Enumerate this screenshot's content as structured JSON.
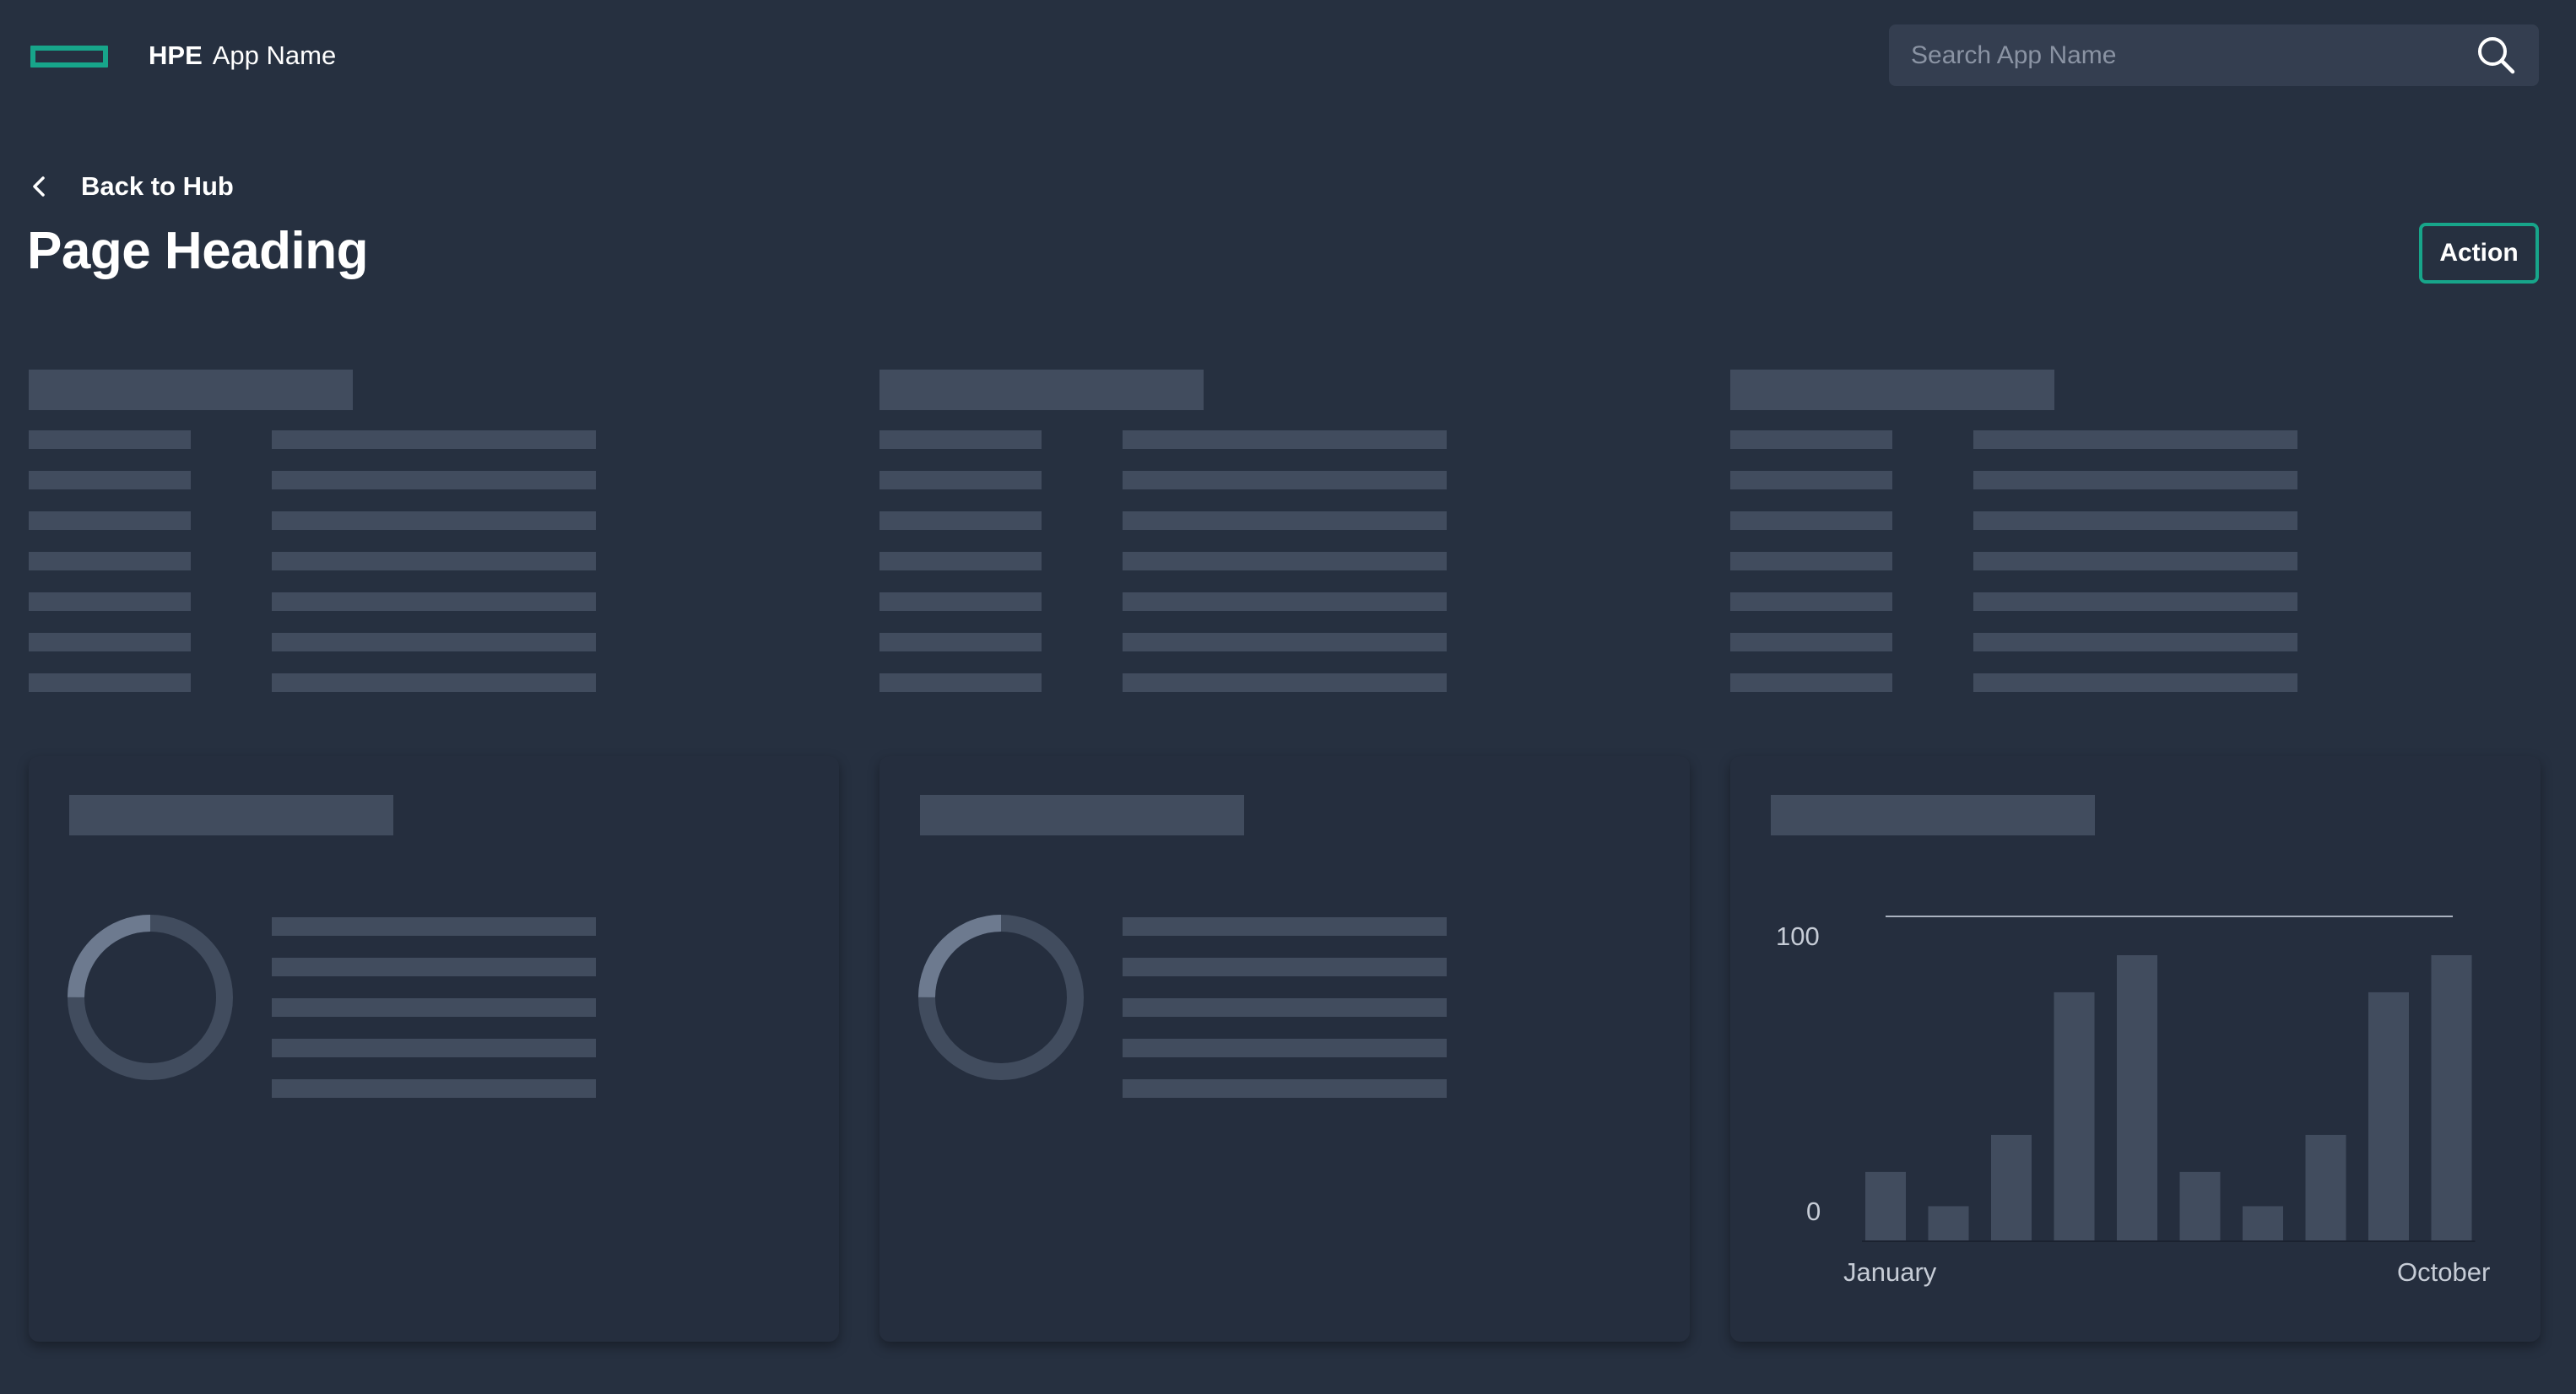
{
  "header": {
    "brand_bold": "HPE",
    "app_name": "App Name",
    "search_placeholder": "Search App Name"
  },
  "nav": {
    "back_label": "Back to Hub"
  },
  "page": {
    "heading": "Page Heading",
    "action_label": "Action"
  },
  "colors": {
    "background": "#263040",
    "card": "#252e3e",
    "skeleton": "#414c5e",
    "accent": "#17a58a",
    "donut_ring": "#414c5e",
    "donut_segment": "#6d7a8f"
  },
  "icons": {
    "search": "search-icon",
    "back": "chevron-left-icon",
    "logo": "hpe-element-logo"
  },
  "chart_data": {
    "type": "bar",
    "title": "",
    "xlabel": "",
    "ylabel": "",
    "x_tick_labels": [
      "January",
      "October"
    ],
    "y_tick_labels": [
      "0",
      "100"
    ],
    "ylim": [
      0,
      100
    ],
    "reference_line": 100,
    "grid": false,
    "categories": [
      "1",
      "2",
      "3",
      "4",
      "5",
      "6",
      "7",
      "8",
      "9",
      "10"
    ],
    "values": [
      24,
      12,
      37,
      87,
      100,
      24,
      12,
      37,
      87,
      100
    ]
  }
}
